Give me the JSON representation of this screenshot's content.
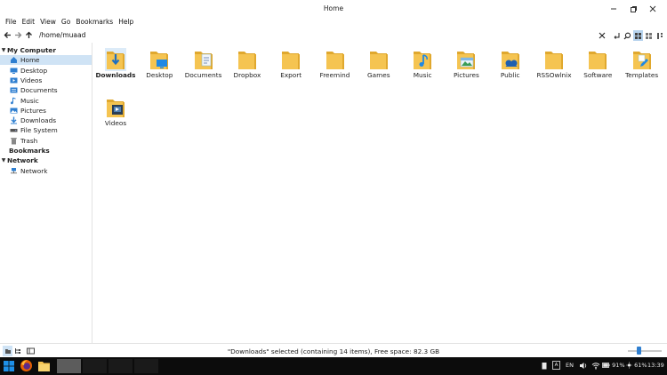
{
  "window": {
    "title": "Home",
    "menu": [
      "File",
      "Edit",
      "View",
      "Go",
      "Bookmarks",
      "Help"
    ]
  },
  "toolbar": {
    "path": "/home/muaad"
  },
  "sidebar": {
    "sections": [
      {
        "label": "My Computer",
        "items": [
          {
            "label": "Home",
            "icon": "home-icon",
            "selected": true
          },
          {
            "label": "Desktop",
            "icon": "desktop-icon"
          },
          {
            "label": "Videos",
            "icon": "videos-icon"
          },
          {
            "label": "Documents",
            "icon": "documents-icon"
          },
          {
            "label": "Music",
            "icon": "music-icon"
          },
          {
            "label": "Pictures",
            "icon": "pictures-icon"
          },
          {
            "label": "Downloads",
            "icon": "downloads-icon"
          },
          {
            "label": "File System",
            "icon": "drive-icon"
          },
          {
            "label": "Trash",
            "icon": "trash-icon"
          }
        ]
      },
      {
        "label": "Bookmarks",
        "items": []
      },
      {
        "label": "Network",
        "items": [
          {
            "label": "Network",
            "icon": "network-icon"
          }
        ]
      }
    ]
  },
  "files": [
    {
      "label": "Downloads",
      "icon": "downloads-folder-icon",
      "selected": true
    },
    {
      "label": "Desktop",
      "icon": "desktop-folder-icon"
    },
    {
      "label": "Documents",
      "icon": "documents-folder-icon"
    },
    {
      "label": "Dropbox",
      "icon": "folder-icon"
    },
    {
      "label": "Export",
      "icon": "folder-icon"
    },
    {
      "label": "Freemind",
      "icon": "folder-icon"
    },
    {
      "label": "Games",
      "icon": "folder-icon"
    },
    {
      "label": "Music",
      "icon": "music-folder-icon"
    },
    {
      "label": "Pictures",
      "icon": "pictures-folder-icon"
    },
    {
      "label": "Public",
      "icon": "public-folder-icon"
    },
    {
      "label": "RSSOwlnix",
      "icon": "folder-icon"
    },
    {
      "label": "Software",
      "icon": "folder-icon"
    },
    {
      "label": "Templates",
      "icon": "templates-folder-icon"
    },
    {
      "label": "Videos",
      "icon": "videos-folder-icon"
    }
  ],
  "status": {
    "text": "\"Downloads\" selected (containing 14 items), Free space: 82.3 GB",
    "zoom_level": 0.3
  },
  "taskbar": {
    "language": "EN",
    "battery": "91%",
    "brightness": "61%",
    "clock": "13:39"
  },
  "colors": {
    "folder": "#f5c451",
    "folder_dark": "#e0a82e",
    "accent": "#2f7fd0",
    "selection": "#cfe3f5"
  }
}
